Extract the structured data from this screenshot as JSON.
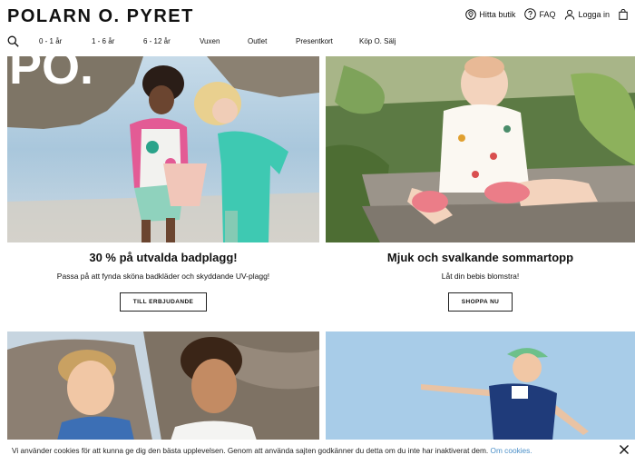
{
  "header": {
    "logo": "POLARN O. PYRET",
    "utils": [
      {
        "label": "Hitta butik",
        "icon": "location-pin-icon"
      },
      {
        "label": "FAQ",
        "icon": "question-circle-icon"
      },
      {
        "label": "Logga in",
        "icon": "user-icon"
      },
      {
        "label": "",
        "icon": "shopping-bag-icon"
      }
    ]
  },
  "nav": {
    "search_icon": "search-icon",
    "items": [
      "0 - 1 år",
      "1 - 6 år",
      "6 - 12 år",
      "Vuxen",
      "Outlet",
      "Presentkort",
      "Köp O. Sälj"
    ]
  },
  "promos": [
    {
      "title": "30 % på utvalda badplagg!",
      "subtitle": "Passa på att fynda sköna badkläder och skyddande UV-plagg!",
      "button": "TILL ERBJUDANDE",
      "overlay_text": "PO."
    },
    {
      "title": "Mjuk och svalkande sommartopp",
      "subtitle": "Låt din bebis blomstra!",
      "button": "SHOPPA NU"
    }
  ],
  "cookie": {
    "message": "Vi använder cookies för att kunna ge dig den bästa upplevelsen. Genom att använda sajten godkänner du detta om du inte har inaktiverat dem.",
    "link": "Om cookies.",
    "close_icon": "close-icon"
  },
  "colors": {
    "link": "#4a8fc8",
    "text": "#111111"
  }
}
